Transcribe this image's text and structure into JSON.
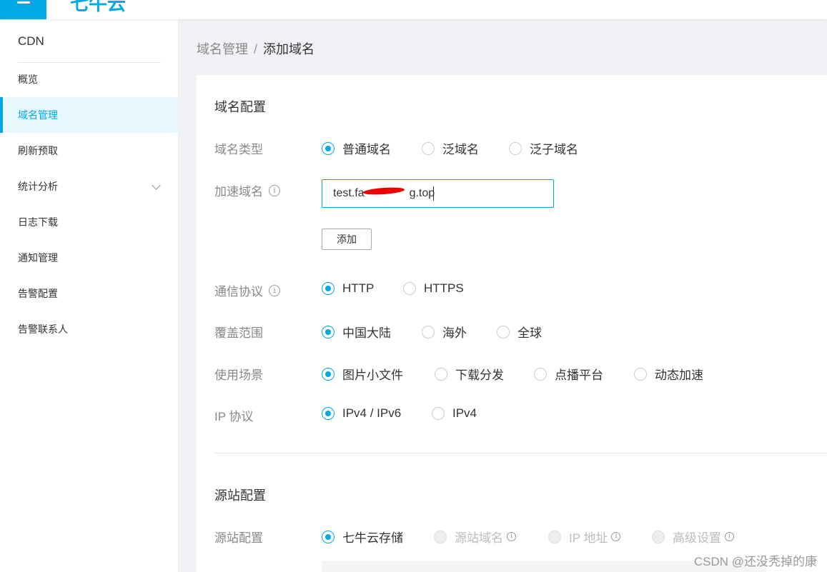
{
  "topbar": {
    "menu_icon": "hamburger-icon",
    "logo_text": "七牛云"
  },
  "sidebar": {
    "title": "CDN",
    "items": [
      {
        "label": "概览"
      },
      {
        "label": "域名管理",
        "active": true
      },
      {
        "label": "刷新预取"
      },
      {
        "label": "统计分析",
        "expandable": true
      },
      {
        "label": "日志下载"
      },
      {
        "label": "通知管理"
      },
      {
        "label": "告警配置"
      },
      {
        "label": "告警联系人"
      }
    ]
  },
  "breadcrumb": {
    "parent": "域名管理",
    "separator": "/",
    "current": "添加域名"
  },
  "domain_config": {
    "section_title": "域名配置",
    "domain_type": {
      "label": "域名类型",
      "options": [
        "普通域名",
        "泛域名",
        "泛子域名"
      ],
      "selected": "普通域名"
    },
    "accel_domain": {
      "label": "加速域名",
      "value": "test.fa█████g.top",
      "value_visible_prefix": "test.fa",
      "value_visible_suffix": "g.top",
      "add_button": "添加"
    },
    "protocol": {
      "label": "通信协议",
      "options": [
        "HTTP",
        "HTTPS"
      ],
      "selected": "HTTP"
    },
    "coverage": {
      "label": "覆盖范围",
      "options": [
        "中国大陆",
        "海外",
        "全球"
      ],
      "selected": "中国大陆"
    },
    "scenario": {
      "label": "使用场景",
      "options": [
        "图片小文件",
        "下载分发",
        "点播平台",
        "动态加速"
      ],
      "selected": "图片小文件"
    },
    "ip_protocol": {
      "label": "IP 协议",
      "options": [
        "IPv4 / IPv6",
        "IPv4"
      ],
      "selected": "IPv4 / IPv6"
    }
  },
  "origin_config": {
    "section_title": "源站配置",
    "origin": {
      "label": "源站配置",
      "options": [
        "七牛云存储",
        "源站域名",
        "IP 地址",
        "高级设置"
      ],
      "selected": "七牛云存储"
    }
  },
  "watermark": "CSDN @还没秃掉的康",
  "colors": {
    "accent": "#00a8e6",
    "active_bg": "#e6f7fd",
    "redaction": "#ee0000"
  }
}
